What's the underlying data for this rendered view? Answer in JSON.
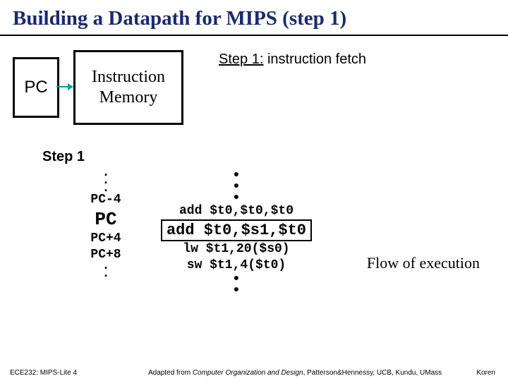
{
  "title": "Building a Datapath for MIPS (step 1)",
  "diagram": {
    "pc_label": "PC",
    "im_label": "Instruction Memory",
    "step_prefix": "Step 1:",
    "step_text": "instruction fetch"
  },
  "step_header": "Step 1",
  "pc_column": {
    "dots_top": [
      ".",
      ".",
      "."
    ],
    "rows": [
      "PC-4",
      "PC",
      "PC+4",
      "PC+8"
    ],
    "current_index": 1,
    "dots_bottom": [
      ".",
      "."
    ]
  },
  "instr_column": {
    "bullets_top": [
      "●",
      "●",
      "●"
    ],
    "rows": [
      "add $t0,$t0,$t0",
      "add $t0,$s1,$t0",
      "lw $t1,20($s0)",
      "sw $t1,4($t0)"
    ],
    "highlight_index": 1,
    "bullets_bottom": [
      "●",
      "●"
    ]
  },
  "flow_label": "Flow of execution",
  "footer": {
    "left": "ECE232: MIPS-Lite 4",
    "mid_prefix": "Adapted from ",
    "mid_ital": "Computer Organization and Design",
    "mid_suffix": ", Patterson&Hennessy, UCB, Kundu, UMass",
    "right": "Koren"
  }
}
